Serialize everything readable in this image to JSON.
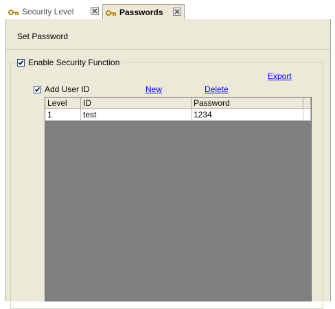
{
  "tabs": [
    {
      "label": "Security Level",
      "active": false,
      "icon": "key-icon"
    },
    {
      "label": "Passwords",
      "active": true,
      "icon": "key-icon"
    }
  ],
  "header": {
    "title": "Set Password"
  },
  "security": {
    "enable_label": "Enable Security Function",
    "enabled": true
  },
  "links": {
    "export": "Export",
    "new": "New",
    "delete": "Delete"
  },
  "user": {
    "add_label": "Add User ID",
    "checked": true
  },
  "table": {
    "columns": [
      "Level",
      "ID",
      "Password"
    ],
    "rows": [
      {
        "level": "1",
        "id": "test",
        "password": "1234"
      }
    ]
  },
  "colors": {
    "panel": "#ece9d8",
    "grid_empty": "#808080",
    "link": "#0000ee"
  }
}
